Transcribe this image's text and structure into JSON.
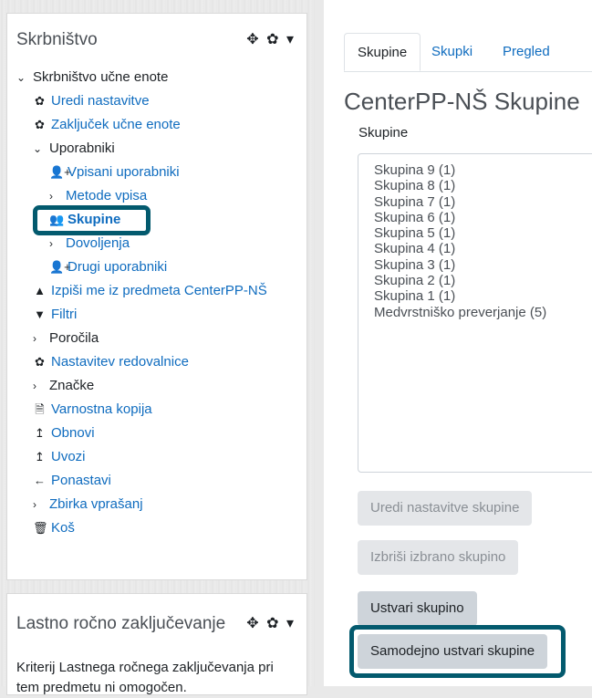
{
  "admin": {
    "title": "Skrbništvo",
    "items": [
      {
        "label": "Skrbništvo učne enote",
        "chev": "⌄",
        "icon": "",
        "level": 0,
        "style": "plain"
      },
      {
        "label": "Uredi nastavitve",
        "chev": "",
        "icon": "✿",
        "level": 1,
        "style": "link"
      },
      {
        "label": "Zaključek učne enote",
        "chev": "",
        "icon": "✿",
        "level": 1,
        "style": "link"
      },
      {
        "label": "Uporabniki",
        "chev": "⌄",
        "icon": "",
        "level": 1,
        "style": "plain"
      },
      {
        "label": "Vpisani uporabniki",
        "chev": "",
        "icon": "👤+",
        "level": 2,
        "style": "link"
      },
      {
        "label": "Metode vpisa",
        "chev": "›",
        "icon": "",
        "level": 2,
        "style": "link"
      },
      {
        "label": "Skupine",
        "chev": "",
        "icon": "👥",
        "level": 2,
        "style": "active"
      },
      {
        "label": "Dovoljenja",
        "chev": "›",
        "icon": "",
        "level": 2,
        "style": "link"
      },
      {
        "label": "Drugi uporabniki",
        "chev": "",
        "icon": "👤+",
        "level": 2,
        "style": "link"
      },
      {
        "label": "Izpiši me iz predmeta CenterPP-NŠ",
        "chev": "",
        "icon": "▲",
        "level": 1,
        "style": "link"
      },
      {
        "label": "Filtri",
        "chev": "",
        "icon": "▼",
        "level": 1,
        "style": "link"
      },
      {
        "label": "Poročila",
        "chev": "›",
        "icon": "",
        "level": 1,
        "style": "plain"
      },
      {
        "label": "Nastavitev redovalnice",
        "chev": "",
        "icon": "✿",
        "level": 1,
        "style": "link"
      },
      {
        "label": "Značke",
        "chev": "›",
        "icon": "",
        "level": 1,
        "style": "plain"
      },
      {
        "label": "Varnostna kopija",
        "chev": "",
        "icon": "🗎",
        "level": 1,
        "style": "link"
      },
      {
        "label": "Obnovi",
        "chev": "",
        "icon": "↥",
        "level": 1,
        "style": "link"
      },
      {
        "label": "Uvozi",
        "chev": "",
        "icon": "↥",
        "level": 1,
        "style": "link"
      },
      {
        "label": "Ponastavi",
        "chev": "",
        "icon": "←",
        "level": 1,
        "style": "link"
      },
      {
        "label": "Zbirka vprašanj",
        "chev": "›",
        "icon": "",
        "level": 1,
        "style": "link"
      },
      {
        "label": "Koš",
        "chev": "",
        "icon": "🗑",
        "level": 1,
        "style": "link"
      }
    ]
  },
  "self_completion": {
    "title": "Lastno ročno zaključevanje",
    "text": "Kriterij Lastnega ročnega zaključevanja pri tem predmetu ni omogočen."
  },
  "main": {
    "tabs": [
      "Skupine",
      "Skupki",
      "Pregled"
    ],
    "page_title": "CenterPP-NŠ Skupine",
    "list_label": "Skupine",
    "groups": [
      "Skupina 9 (1)",
      "Skupina 8 (1)",
      "Skupina 7 (1)",
      "Skupina 6 (1)",
      "Skupina 5 (1)",
      "Skupina 4 (1)",
      "Skupina 3 (1)",
      "Skupina 2 (1)",
      "Skupina 1 (1)",
      "Medvrstniško preverjanje (5)"
    ],
    "buttons": {
      "edit": "Uredi nastavitve skupine",
      "delete": "Izbriši izbrano skupino",
      "create": "Ustvari skupino",
      "auto_create": "Samodejno ustvari skupine"
    }
  },
  "icons": {
    "move": "✥",
    "gear": "✿",
    "caret": "▾"
  }
}
